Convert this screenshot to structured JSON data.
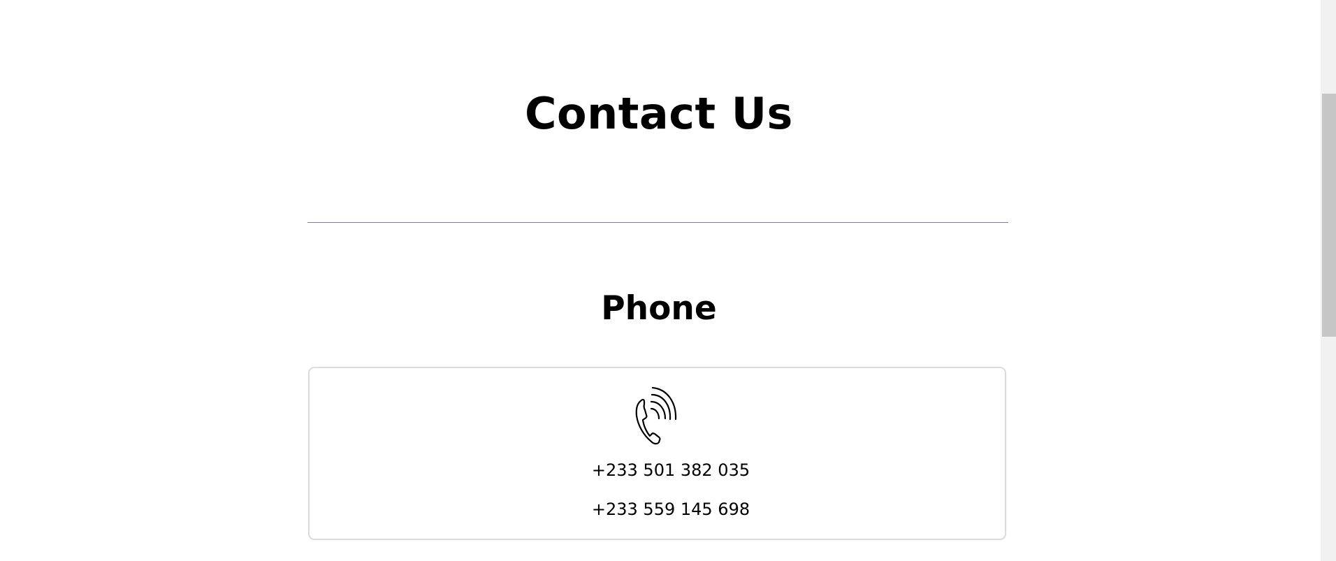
{
  "page": {
    "title": "Contact Us"
  },
  "phone_section": {
    "heading": "Phone",
    "icon": "phone-ringing-icon",
    "numbers": [
      "+233 501 382 035",
      "+233 559 145 698"
    ]
  },
  "colors": {
    "divider": "#7d7d9b",
    "card_border": "#dcdcdc",
    "scrollbar_track": "#f1f1f1",
    "scrollbar_thumb": "#c6c6c6"
  }
}
